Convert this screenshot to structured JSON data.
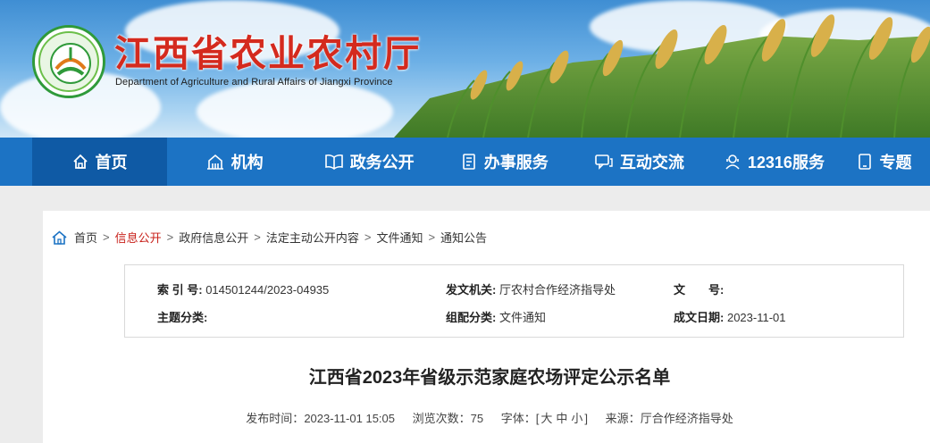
{
  "header": {
    "title": "江西省农业农村厅",
    "subtitle": "Department of Agriculture and Rural Affairs of Jiangxi Province",
    "logo_icon": "provincial-agri-logo",
    "title_color": "#d42a1e"
  },
  "nav": {
    "items": [
      {
        "label": "首页",
        "icon": "home-icon",
        "active": true
      },
      {
        "label": "机构",
        "icon": "building-icon"
      },
      {
        "label": "政务公开",
        "icon": "book-icon"
      },
      {
        "label": "办事服务",
        "icon": "document-icon"
      },
      {
        "label": "互动交流",
        "icon": "chat-icon"
      },
      {
        "label": "12316服务",
        "icon": "support-icon"
      },
      {
        "label": "专题",
        "icon": "tablet-icon"
      }
    ],
    "bg_color": "#1c73c4",
    "active_color": "#0f5aa5"
  },
  "breadcrumb": {
    "items": [
      "首页",
      "信息公开",
      "政府信息公开",
      "法定主动公开内容",
      "文件通知",
      "通知公告"
    ],
    "highlight_index": 1
  },
  "meta": {
    "index_label": "索 引 号:",
    "index_value": "014501244/2023-04935",
    "issuer_label": "发文机关:",
    "issuer_value": "厅农村合作经济指导处",
    "docno_label": "文　　号:",
    "docno_value": "",
    "topic_label": "主题分类:",
    "topic_value": "",
    "category_label": "组配分类:",
    "category_value": "文件通知",
    "date_label": "成文日期:",
    "date_value": "2023-11-01"
  },
  "article": {
    "title": "江西省2023年省级示范家庭农场评定公示名单",
    "publish_label": "发布时间：",
    "publish_time": "2023-11-01 15:05",
    "views_label": "浏览次数：",
    "views": "75",
    "font_label": "字体：",
    "font_open": "[",
    "font_large": "大",
    "font_medium": "中",
    "font_small": "小",
    "font_close": "]",
    "source_label": "来源：",
    "source": "厅合作经济指导处"
  }
}
